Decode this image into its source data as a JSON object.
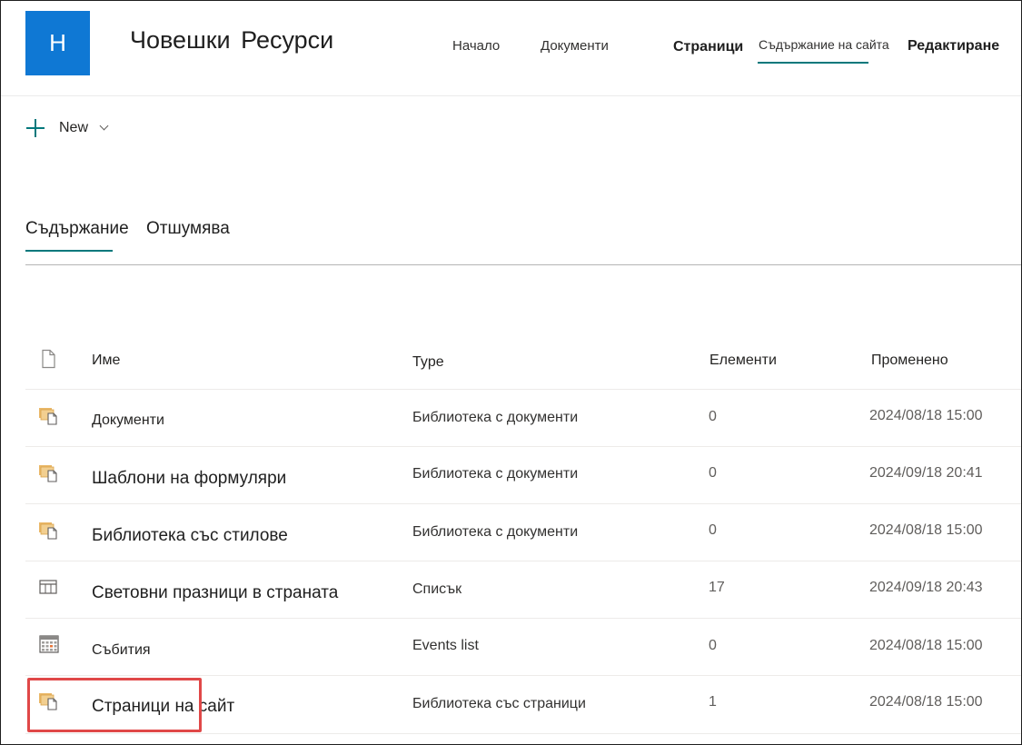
{
  "site": {
    "logo_letter": "H",
    "title": "Човешки  Ресурси",
    "brand_color": "#0f78d4",
    "accent_color": "#03787c"
  },
  "nav": {
    "home": "Начало",
    "documents": "Документи",
    "pages": "Страници",
    "site_contents": "Съдържание на сайта",
    "edit": "Редактиране"
  },
  "command_bar": {
    "new_label": "New",
    "new_icon": "plus-icon",
    "dropdown_icon": "chevron-down-icon"
  },
  "tabs": {
    "contents": "Съдържание",
    "recycle_bin": "Отшумява"
  },
  "table": {
    "headers": {
      "file_icon": "file-icon",
      "name": "Име",
      "type": "Type",
      "items": "Елементи",
      "modified": "Променено"
    },
    "rows": [
      {
        "icon": "document-library-icon",
        "name": "Документи",
        "type": "Библиотека с документи",
        "items": "0",
        "modified": "2024/08/18 15:00"
      },
      {
        "icon": "document-library-icon",
        "name": "Шаблони на формуляри",
        "type": "Библиотека с документи",
        "items": "0",
        "modified": "2024/09/18 20:41"
      },
      {
        "icon": "document-library-icon",
        "name": "Библиотека със стилове",
        "type": "Библиотека с документи",
        "items": "0",
        "modified": "2024/08/18 15:00"
      },
      {
        "icon": "list-icon",
        "name": "Световни празници в страната",
        "type": "Списък",
        "items": "17",
        "modified": "2024/09/18 20:43"
      },
      {
        "icon": "calendar-icon",
        "name": "Събития",
        "type": "Events list",
        "items": "0",
        "modified": "2024/08/18 15:00"
      },
      {
        "icon": "document-library-icon",
        "name": "Страници на сайт",
        "type": "Библиотека със страници",
        "items": "1",
        "modified": "2024/08/18 15:00"
      }
    ]
  },
  "highlight_color": "#e04848"
}
